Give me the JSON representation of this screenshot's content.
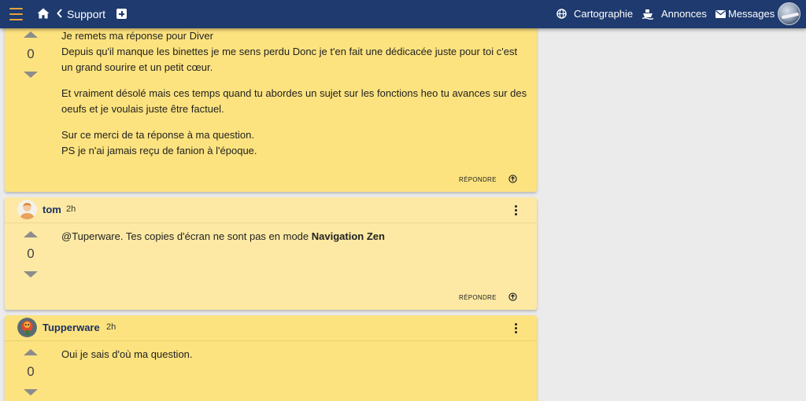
{
  "header": {
    "breadcrumb": "Support",
    "nav": {
      "cartographie": "Cartographie",
      "annonces": "Annonces",
      "messages": "Messages"
    }
  },
  "posts": [
    {
      "votes": "0",
      "lines": [
        "Je remets ma réponse pour Diver",
        "Depuis qu'il manque les binettes je me sens perdu Donc je t'en fait une dédicacée juste pour toi c'est un grand sourire et un petit cœur.",
        "Et vraiment désolé mais ces temps quand tu abordes un sujet sur les fonctions heo tu avances sur des oeufs et je voulais juste être factuel.",
        "Sur ce merci de ta réponse à ma question.",
        "PS je n'ai jamais reçu de fanion à l'époque."
      ],
      "reply_label": "RÉPONDRE"
    },
    {
      "author": "tom",
      "time": "2h",
      "votes": "0",
      "text_prefix": "@Tuperware. Tes copies d'écran ne sont pas en mode ",
      "text_bold": "Navigation Zen",
      "reply_label": "RÉPONDRE"
    },
    {
      "author": "Tupperware",
      "time": "2h",
      "votes": "0",
      "text": "Oui je sais d'où ma question."
    }
  ],
  "colors": {
    "topbar": "#1e3a6e",
    "post_bg": "#fde37f",
    "post_bg_light": "#fde9a3",
    "author_name": "#1b3168",
    "menu_accent": "#e8a33c"
  },
  "icons": {
    "menu": "hamburger-menu-icon",
    "home": "home-icon",
    "back": "chevron-left-icon",
    "new": "plus-square-icon",
    "cartographie": "globe-icon",
    "annonces": "ship-icon",
    "messages": "envelope-icon",
    "more": "kebab-menu-icon",
    "reply": "arrow-up-circle-icon"
  }
}
